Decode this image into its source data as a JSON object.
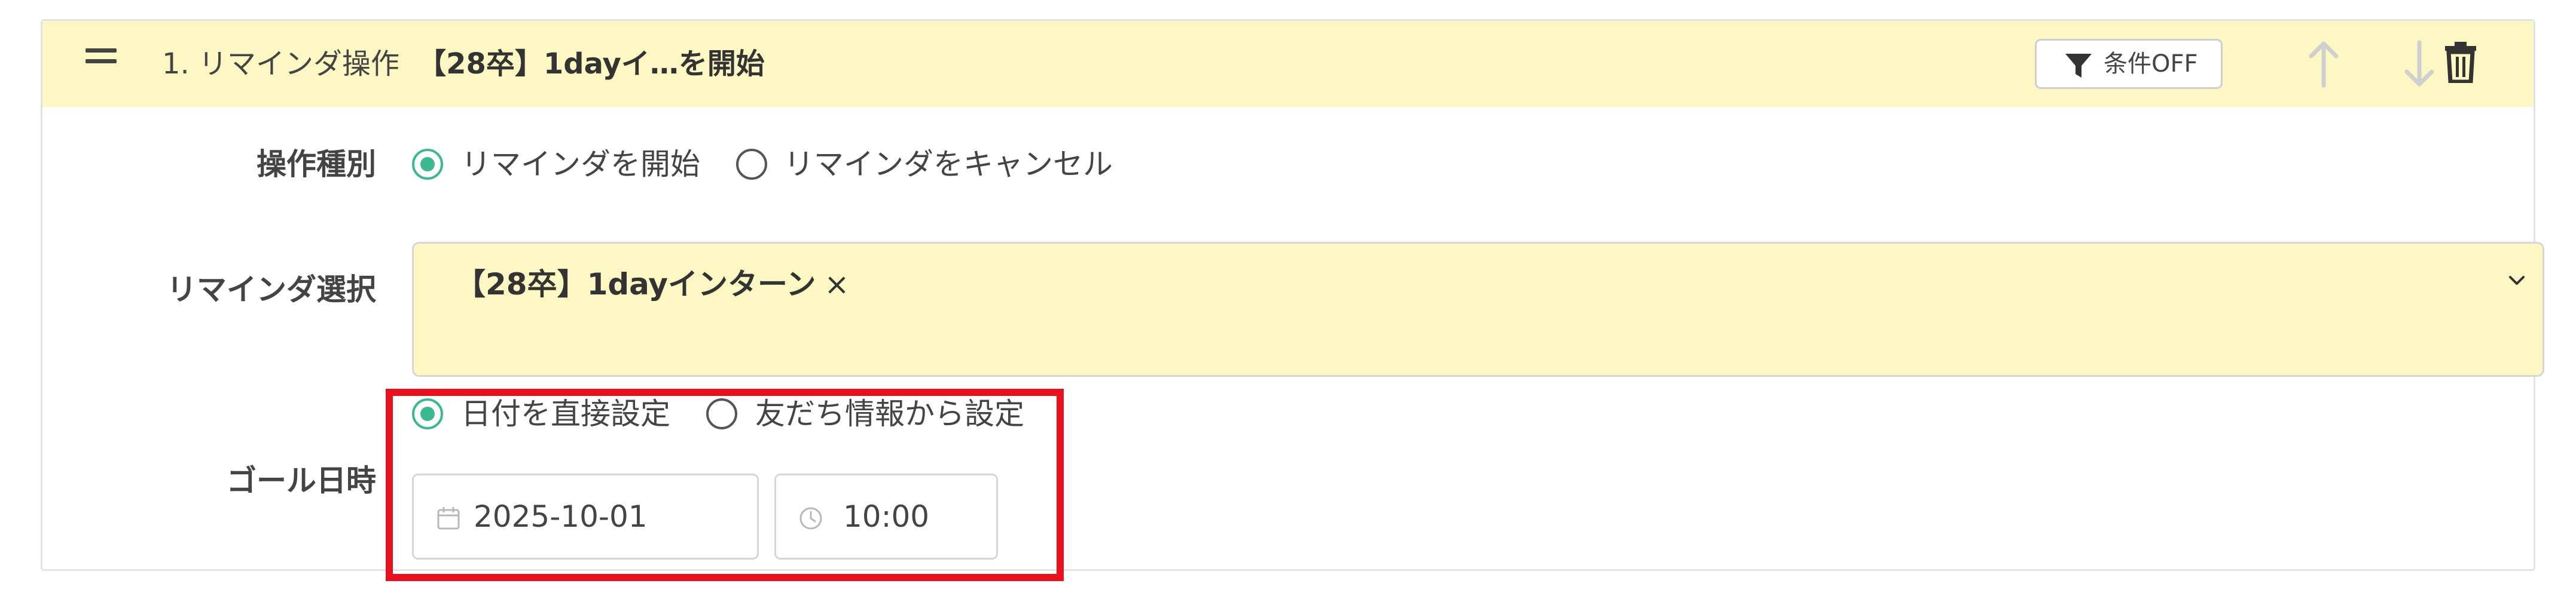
{
  "header": {
    "title_prefix": "1. リマインダ操作",
    "title_name": "【28卒】1dayイ…を開始",
    "condition_button": "条件OFF",
    "background_color": "#fdf8c3"
  },
  "operation_type": {
    "label": "操作種別",
    "options": [
      {
        "label": "リマインダを開始",
        "checked": true
      },
      {
        "label": "リマインダをキャンセル",
        "checked": false
      }
    ]
  },
  "reminder_select": {
    "label": "リマインダ選択",
    "selected": "【28卒】1dayインターン",
    "remove_glyph": "×"
  },
  "goal_datetime": {
    "label": "ゴール日時",
    "options": [
      {
        "label": "日付を直接設定",
        "checked": true
      },
      {
        "label": "友だち情報から設定",
        "checked": false
      }
    ],
    "date": "2025-10-01",
    "time": "10:00"
  },
  "colors": {
    "accent_green": "#3cb88f",
    "highlight_red": "#e8101d"
  },
  "icons": [
    "drag-handle-icon",
    "filter-icon",
    "arrow-up-icon",
    "arrow-down-icon",
    "trash-icon",
    "chevron-down-icon",
    "calendar-icon",
    "clock-icon"
  ]
}
